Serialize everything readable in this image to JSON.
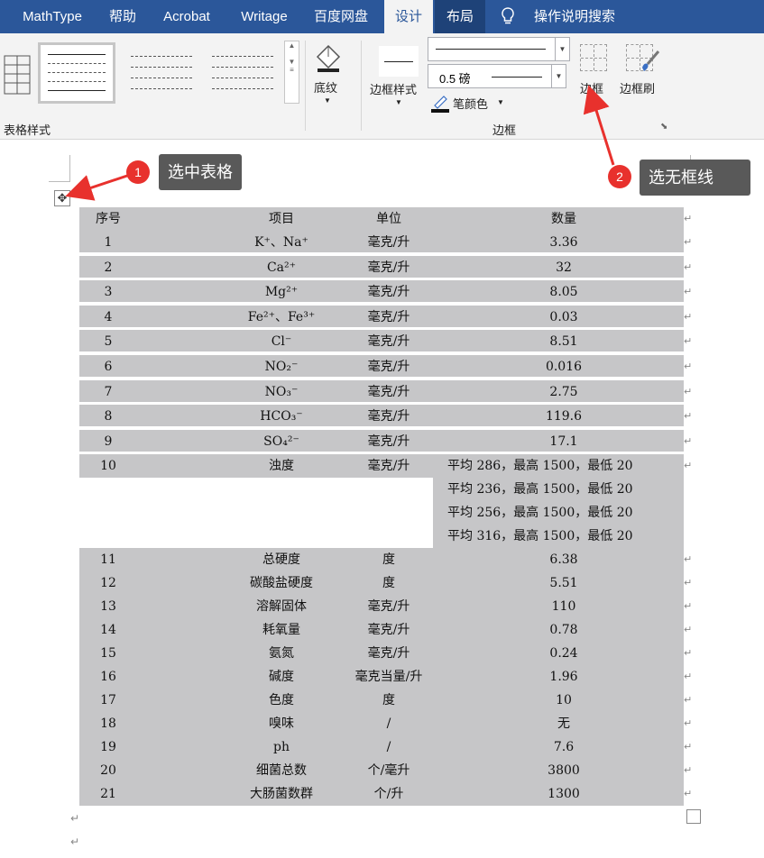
{
  "tabs": [
    "MathType",
    "帮助",
    "Acrobat",
    "Writage",
    "百度网盘",
    "设计",
    "布局",
    "操作说明搜索"
  ],
  "ribbon": {
    "table_styles_label": "表格样式",
    "shading_label": "底纹",
    "border_styles_label": "边框样式",
    "line_weight": "0.5 磅",
    "pen_color_label": "笔颜色",
    "borders_label": "边框",
    "border_painter_label": "边框刷",
    "group_borders": "边框"
  },
  "annotations": [
    {
      "num": "1",
      "text": "选中表格"
    },
    {
      "num": "2",
      "text": "选无框线"
    }
  ],
  "table": {
    "header": [
      "序号",
      "项目",
      "单位",
      "数量"
    ],
    "rows": [
      [
        "1",
        "K⁺、Na⁺",
        "毫克/升",
        "3.36"
      ],
      [
        "2",
        "Ca²⁺",
        "毫克/升",
        "32"
      ],
      [
        "3",
        "Mg²⁺",
        "毫克/升",
        "8.05"
      ],
      [
        "4",
        "Fe²⁺、Fe³⁺",
        "毫克/升",
        "0.03"
      ],
      [
        "5",
        "Cl⁻",
        "毫克/升",
        "8.51"
      ],
      [
        "6",
        "NO₂⁻",
        "毫克/升",
        "0.016"
      ],
      [
        "7",
        "NO₃⁻",
        "毫克/升",
        "2.75"
      ],
      [
        "8",
        "HCO₃⁻",
        "毫克/升",
        "119.6"
      ],
      [
        "9",
        "SO₄²⁻",
        "毫克/升",
        "17.1"
      ],
      [
        "10",
        "浊度",
        "毫克/升",
        "平均 286，最高 1500，最低 20"
      ]
    ],
    "turbidity_extra": [
      "平均 236，最高 1500，最低 20",
      "平均 256，最高 1500，最低 20",
      "平均 316，最高 1500，最低 20"
    ],
    "rows2": [
      [
        "11",
        "总硬度",
        "度",
        "6.38"
      ],
      [
        "12",
        "碳酸盐硬度",
        "度",
        "5.51"
      ],
      [
        "13",
        "溶解固体",
        "毫克/升",
        "110"
      ],
      [
        "14",
        "耗氧量",
        "毫克/升",
        "0.78"
      ],
      [
        "15",
        "氨氮",
        "毫克/升",
        "0.24"
      ],
      [
        "16",
        "碱度",
        "毫克当量/升",
        "1.96"
      ],
      [
        "17",
        "色度",
        "度",
        "10"
      ],
      [
        "18",
        "嗅味",
        "/",
        "无"
      ],
      [
        "19",
        "ph",
        "/",
        "7.6"
      ],
      [
        "20",
        "细菌总数",
        "个/毫升",
        "3800"
      ],
      [
        "21",
        "大肠菌数群",
        "个/升",
        "1300"
      ]
    ]
  },
  "marks": {
    "return": "↵"
  }
}
